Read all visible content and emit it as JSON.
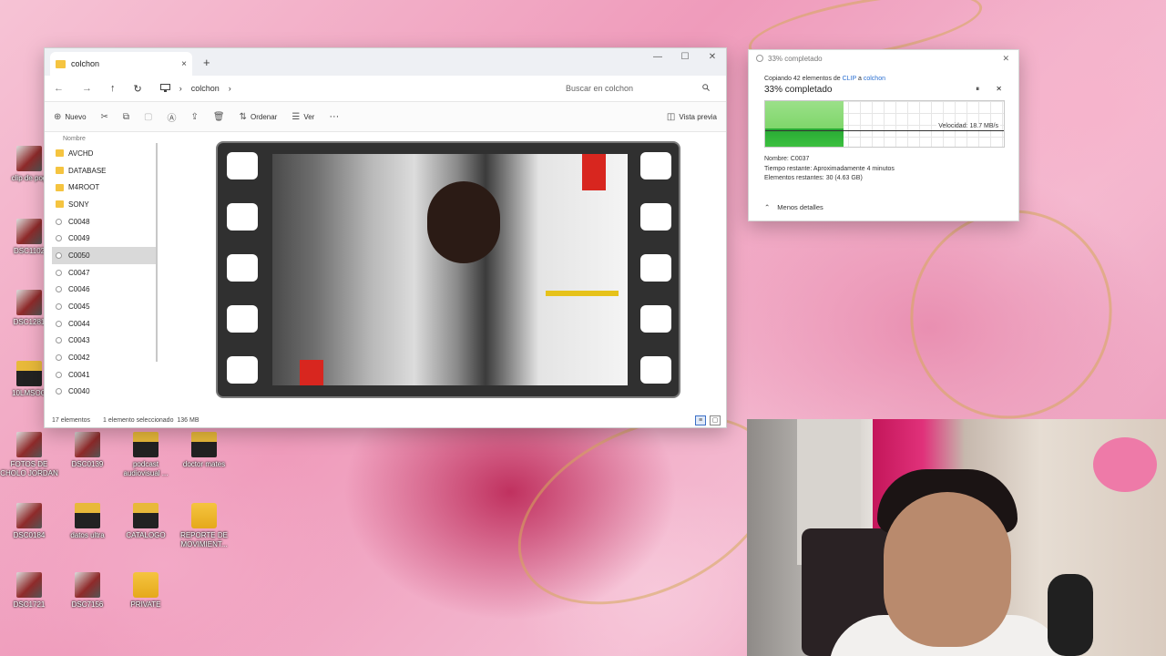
{
  "desktop": {
    "icons": [
      {
        "label": "clip de pog"
      },
      {
        "label": "DSC1102"
      },
      {
        "label": "DSC1281"
      },
      {
        "label": "10LMSOG"
      },
      {
        "label": "FOTOS DE CHOLO JORDAN"
      },
      {
        "label": "DSC0139"
      },
      {
        "label": "podcast audiovisual ..."
      },
      {
        "label": "doctor mates"
      },
      {
        "label": "DSC0184"
      },
      {
        "label": "datos ultra"
      },
      {
        "label": "CATALOGO"
      },
      {
        "label": "REPORTE DE MOVIMIENT..."
      },
      {
        "label": "DSC1721"
      },
      {
        "label": "DSC7156"
      },
      {
        "label": "PRIVATE"
      }
    ]
  },
  "explorer": {
    "tab_title": "colchon",
    "tab_close": "×",
    "new_tab": "+",
    "window_controls": [
      "—",
      "☐",
      "✕"
    ],
    "nav": {
      "back": "←",
      "forward": "→",
      "up": "↑",
      "refresh": "↻"
    },
    "address": {
      "pc_icon": "monitor-icon",
      "sep": "›",
      "folder": "colchon",
      "sep2": "›"
    },
    "search_placeholder": "Buscar en colchon",
    "commands": {
      "new": "Nuevo",
      "sort": "Ordenar",
      "view": "Ver",
      "more": "···",
      "preview": "Vista previa"
    },
    "column_header": "Nombre",
    "files": [
      {
        "name": "AVCHD",
        "type": "folder"
      },
      {
        "name": "DATABASE",
        "type": "folder"
      },
      {
        "name": "M4ROOT",
        "type": "folder"
      },
      {
        "name": "SONY",
        "type": "folder"
      },
      {
        "name": "C0048",
        "type": "video"
      },
      {
        "name": "C0049",
        "type": "video"
      },
      {
        "name": "C0050",
        "type": "video",
        "selected": true
      },
      {
        "name": "C0047",
        "type": "video"
      },
      {
        "name": "C0046",
        "type": "video"
      },
      {
        "name": "C0045",
        "type": "video"
      },
      {
        "name": "C0044",
        "type": "video"
      },
      {
        "name": "C0043",
        "type": "video"
      },
      {
        "name": "C0042",
        "type": "video"
      },
      {
        "name": "C0041",
        "type": "video"
      },
      {
        "name": "C0040",
        "type": "video"
      }
    ],
    "status": {
      "count": "17 elementos",
      "selected": "1 elemento seleccionado",
      "size": "136 MB"
    }
  },
  "copy_dialog": {
    "title": "33% completado",
    "close": "✕",
    "info_prefix": "Copiando 42 elementos de ",
    "source": "CLIP",
    "info_mid": " a ",
    "dest": "colchon",
    "percent_label": "33% completado",
    "pause": "⏸",
    "cancel": "✕",
    "progress": 0.33,
    "speed": "Velocidad: 18.7 MB/s",
    "name": "Nombre: C0037",
    "time_left": "Tiempo restante: Aproximadamente 4 minutos",
    "items_left": "Elementos restantes: 30 (4.63 GB)",
    "less_details": "Menos detalles",
    "less_details_icon": "chevron-up-icon"
  },
  "colors": {
    "accent_link": "#2a6fd1",
    "progress_green": "#3cc03f",
    "folder_yellow": "#f5c440"
  }
}
